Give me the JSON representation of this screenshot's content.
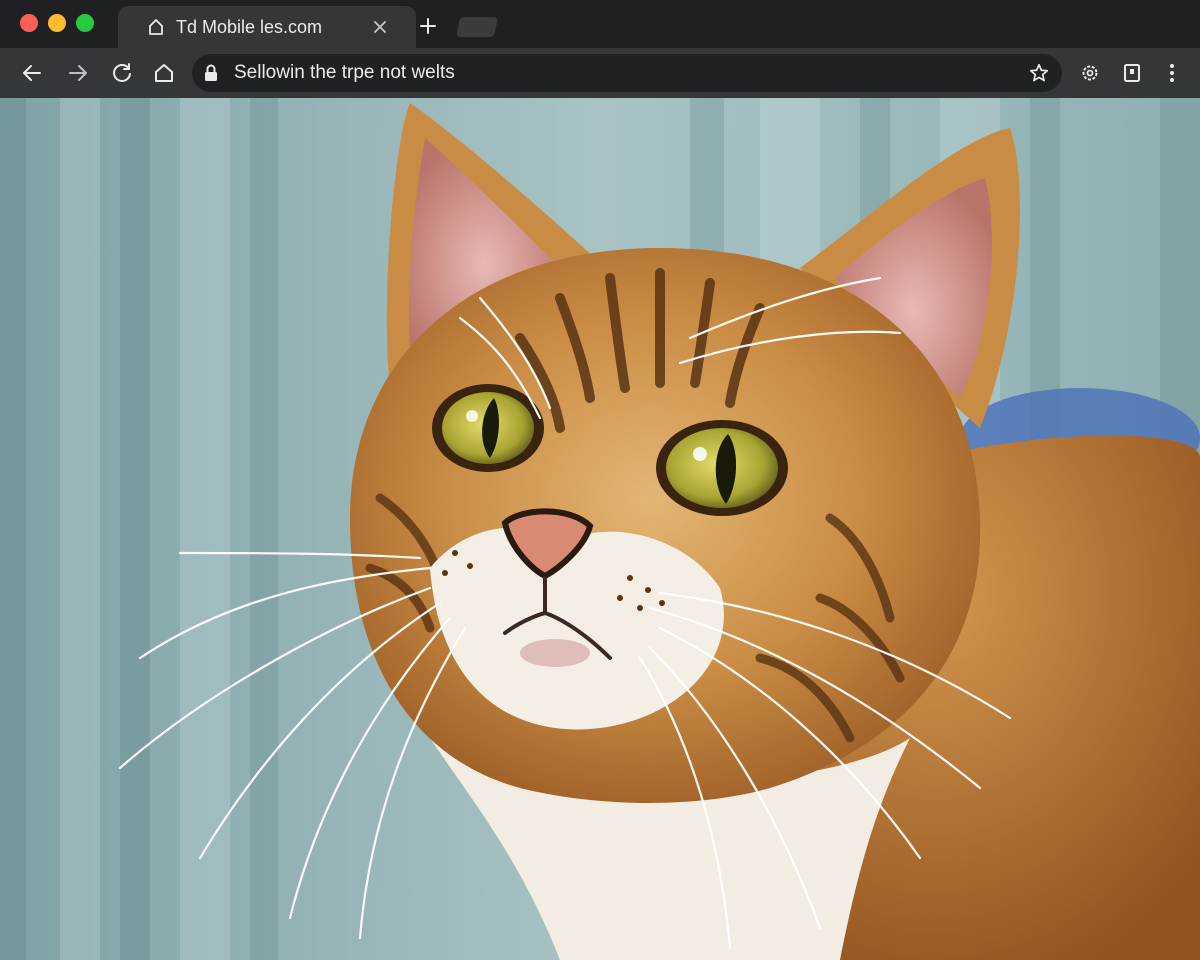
{
  "window": {
    "controls": {
      "close_color": "#ff5f57",
      "minimize_color": "#febc2e",
      "maximize_color": "#28c840"
    }
  },
  "tab": {
    "title": "Td Mobile les.com",
    "favicon_icon": "home-outline-icon",
    "close_icon": "close-icon"
  },
  "toolbar": {
    "back_icon": "arrow-left-icon",
    "forward_icon": "arrow-right-icon",
    "reload_icon": "reload-icon",
    "home_icon": "home-icon",
    "url": "Sellowin the trpe not welts",
    "lock_icon": "lock-icon",
    "bookmark_icon": "star-icon",
    "extensions_icon": "gear-icon",
    "profile_icon": "tablet-icon",
    "menu_icon": "kebab-menu-icon"
  },
  "content": {
    "image": "tabby-cat-photo",
    "accent_background": "#9fb7b9"
  }
}
